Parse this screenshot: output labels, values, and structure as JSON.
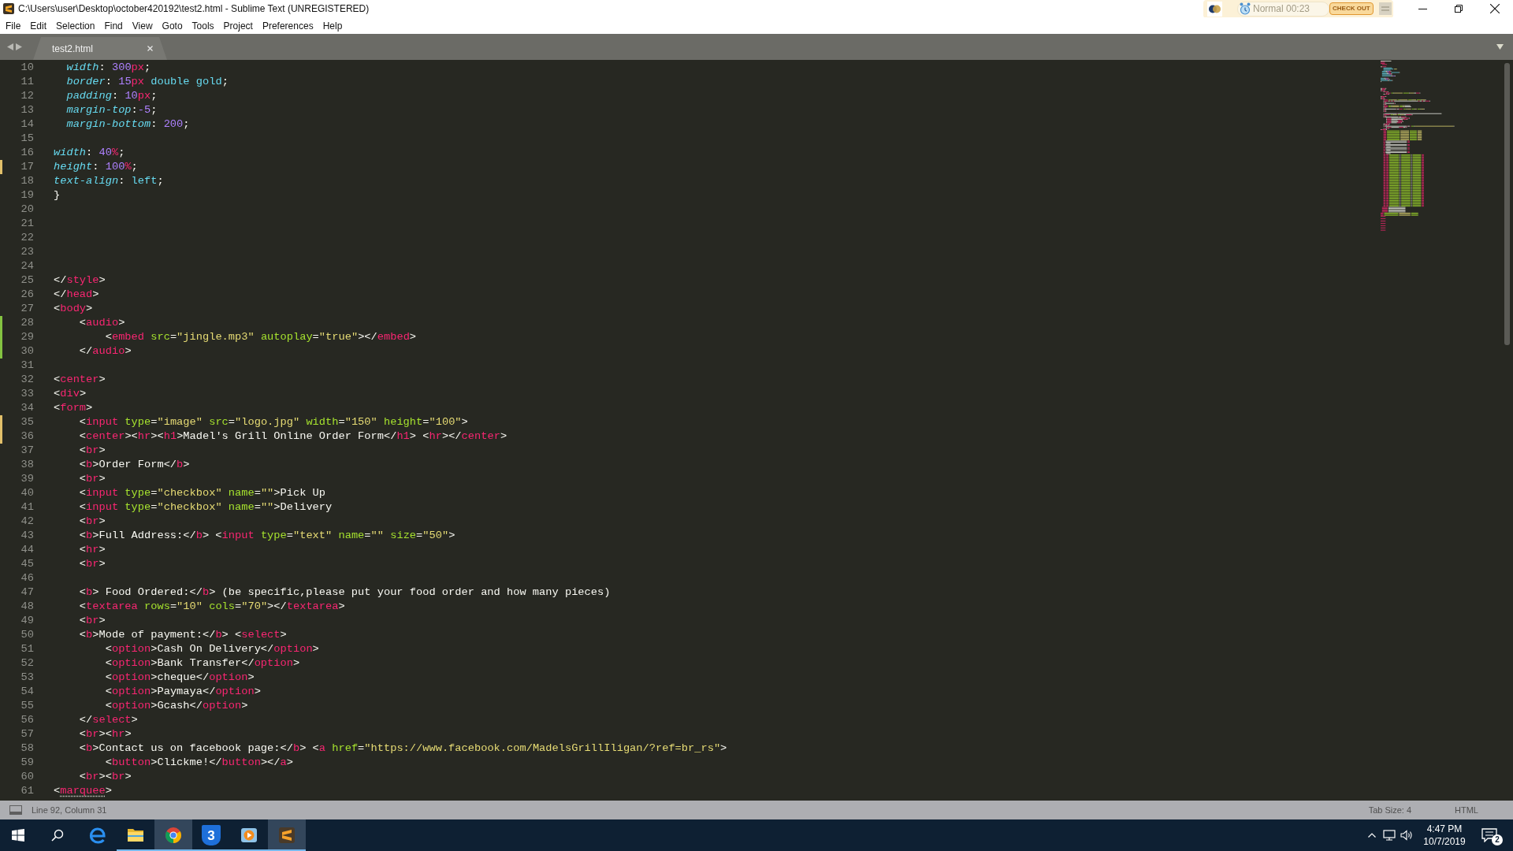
{
  "window": {
    "title": "C:\\Users\\user\\Desktop\\october420192\\test2.html - Sublime Text (UNREGISTERED)"
  },
  "recorder_widget": {
    "status": "Normal 00:23",
    "button": "CHECK OUT"
  },
  "menu": [
    "File",
    "Edit",
    "Selection",
    "Find",
    "View",
    "Goto",
    "Tools",
    "Project",
    "Preferences",
    "Help"
  ],
  "tabs": [
    {
      "label": "test2.html",
      "selected": true
    }
  ],
  "editor": {
    "lines": [
      {
        "number": "10",
        "tokens": [
          {
            "kind": "prop",
            "text": "  width"
          },
          {
            "kind": "plain",
            "text": ": "
          },
          {
            "kind": "num",
            "text": "300"
          },
          {
            "kind": "unit",
            "text": "px"
          },
          {
            "kind": "plain",
            "text": ";"
          }
        ]
      },
      {
        "number": "11",
        "tokens": [
          {
            "kind": "prop",
            "text": "  border"
          },
          {
            "kind": "plain",
            "text": ": "
          },
          {
            "kind": "num",
            "text": "15"
          },
          {
            "kind": "unit",
            "text": "px"
          },
          {
            "kind": "const",
            "text": " double gold"
          },
          {
            "kind": "plain",
            "text": ";"
          }
        ]
      },
      {
        "number": "12",
        "tokens": [
          {
            "kind": "prop",
            "text": "  padding"
          },
          {
            "kind": "plain",
            "text": ": "
          },
          {
            "kind": "num",
            "text": "10"
          },
          {
            "kind": "unit",
            "text": "px"
          },
          {
            "kind": "plain",
            "text": ";"
          }
        ]
      },
      {
        "number": "13",
        "tokens": [
          {
            "kind": "prop",
            "text": "  margin-top"
          },
          {
            "kind": "plain",
            "text": ":"
          },
          {
            "kind": "num",
            "text": "-5"
          },
          {
            "kind": "plain",
            "text": ";"
          }
        ]
      },
      {
        "number": "14",
        "tokens": [
          {
            "kind": "prop",
            "text": "  margin-bottom"
          },
          {
            "kind": "plain",
            "text": ": "
          },
          {
            "kind": "num",
            "text": "200"
          },
          {
            "kind": "plain",
            "text": ";"
          }
        ]
      },
      {
        "number": "15"
      },
      {
        "number": "16",
        "tokens": [
          {
            "kind": "prop",
            "text": "width"
          },
          {
            "kind": "plain",
            "text": ": "
          },
          {
            "kind": "num",
            "text": "40"
          },
          {
            "kind": "unit",
            "text": "%"
          },
          {
            "kind": "plain",
            "text": ";"
          }
        ]
      },
      {
        "number": "17",
        "color": "#e2c06a",
        "tokens": [
          {
            "kind": "prop",
            "text": "height"
          },
          {
            "kind": "plain",
            "text": ": "
          },
          {
            "kind": "num",
            "text": "100"
          },
          {
            "kind": "unit",
            "text": "%"
          },
          {
            "kind": "plain",
            "text": ";"
          }
        ]
      },
      {
        "number": "18",
        "tokens": [
          {
            "kind": "prop",
            "text": "text-align"
          },
          {
            "kind": "plain",
            "text": ": "
          },
          {
            "kind": "const",
            "text": "left"
          },
          {
            "kind": "plain",
            "text": ";"
          }
        ]
      },
      {
        "number": "19",
        "tokens": [
          {
            "kind": "plain",
            "text": "}"
          }
        ]
      },
      {
        "number": "20"
      },
      {
        "number": "21"
      },
      {
        "number": "22"
      },
      {
        "number": "23"
      },
      {
        "number": "24"
      },
      {
        "number": "25",
        "tokens": [
          {
            "kind": "plain",
            "text": "</"
          },
          {
            "kind": "tag",
            "text": "style"
          },
          {
            "kind": "plain",
            "text": ">"
          }
        ]
      },
      {
        "number": "26",
        "tokens": [
          {
            "kind": "plain",
            "text": "</"
          },
          {
            "kind": "tag",
            "text": "head"
          },
          {
            "kind": "plain",
            "text": ">"
          }
        ]
      },
      {
        "number": "27",
        "tokens": [
          {
            "kind": "plain",
            "text": "<"
          },
          {
            "kind": "tag",
            "text": "body"
          },
          {
            "kind": "plain",
            "text": ">"
          }
        ]
      },
      {
        "number": "28",
        "color": "#84c341",
        "tokens": [
          {
            "kind": "plain",
            "text": "\t<"
          },
          {
            "kind": "tag",
            "text": "audio"
          },
          {
            "kind": "plain",
            "text": ">"
          }
        ]
      },
      {
        "number": "29",
        "color": "#84c341",
        "tokens": [
          {
            "kind": "plain",
            "text": "\t\t<"
          },
          {
            "kind": "tag",
            "text": "embed"
          },
          {
            "kind": "attr",
            "text": " src"
          },
          {
            "kind": "plain",
            "text": "="
          },
          {
            "kind": "str",
            "text": "\"jingle.mp3\""
          },
          {
            "kind": "attr",
            "text": " autoplay"
          },
          {
            "kind": "plain",
            "text": "="
          },
          {
            "kind": "str",
            "text": "\"true\""
          },
          {
            "kind": "plain",
            "text": "></"
          },
          {
            "kind": "tag",
            "text": "embed"
          },
          {
            "kind": "plain",
            "text": ">"
          }
        ]
      },
      {
        "number": "30",
        "color": "#84c341",
        "tokens": [
          {
            "kind": "plain",
            "text": "\t</"
          },
          {
            "kind": "tag",
            "text": "audio"
          },
          {
            "kind": "plain",
            "text": ">"
          }
        ]
      },
      {
        "number": "31"
      },
      {
        "number": "32",
        "tokens": [
          {
            "kind": "plain",
            "text": "<"
          },
          {
            "kind": "tag",
            "text": "center"
          },
          {
            "kind": "plain",
            "text": ">"
          }
        ]
      },
      {
        "number": "33",
        "tokens": [
          {
            "kind": "plain",
            "text": "<"
          },
          {
            "kind": "tag",
            "text": "div"
          },
          {
            "kind": "plain",
            "text": ">"
          }
        ]
      },
      {
        "number": "34",
        "tokens": [
          {
            "kind": "plain",
            "text": "<"
          },
          {
            "kind": "tag",
            "text": "form"
          },
          {
            "kind": "plain",
            "text": ">"
          }
        ]
      },
      {
        "number": "35",
        "color": "#e2c06a",
        "tokens": [
          {
            "kind": "plain",
            "text": "\t<"
          },
          {
            "kind": "tag",
            "text": "input"
          },
          {
            "kind": "attr",
            "text": " type"
          },
          {
            "kind": "plain",
            "text": "="
          },
          {
            "kind": "str",
            "text": "\"image\""
          },
          {
            "kind": "attr",
            "text": " src"
          },
          {
            "kind": "plain",
            "text": "="
          },
          {
            "kind": "str",
            "text": "\"logo.jpg\""
          },
          {
            "kind": "attr",
            "text": " width"
          },
          {
            "kind": "plain",
            "text": "="
          },
          {
            "kind": "str",
            "text": "\"150\""
          },
          {
            "kind": "attr",
            "text": " height"
          },
          {
            "kind": "plain",
            "text": "="
          },
          {
            "kind": "str",
            "text": "\"100\""
          },
          {
            "kind": "plain",
            "text": ">"
          }
        ]
      },
      {
        "number": "36",
        "color": "#e2c06a",
        "tokens": [
          {
            "kind": "plain",
            "text": "\t<"
          },
          {
            "kind": "tag",
            "text": "center"
          },
          {
            "kind": "plain",
            "text": "><"
          },
          {
            "kind": "tag",
            "text": "hr"
          },
          {
            "kind": "plain",
            "text": "><"
          },
          {
            "kind": "tag",
            "text": "h1"
          },
          {
            "kind": "plain",
            "text": ">Madel's Grill Online Order Form</"
          },
          {
            "kind": "tag",
            "text": "h1"
          },
          {
            "kind": "plain",
            "text": "> <"
          },
          {
            "kind": "tag",
            "text": "hr"
          },
          {
            "kind": "plain",
            "text": "></"
          },
          {
            "kind": "tag",
            "text": "center"
          },
          {
            "kind": "plain",
            "text": ">"
          }
        ]
      },
      {
        "number": "37",
        "tokens": [
          {
            "kind": "plain",
            "text": "\t<"
          },
          {
            "kind": "tag",
            "text": "br"
          },
          {
            "kind": "plain",
            "text": ">"
          }
        ]
      },
      {
        "number": "38",
        "tokens": [
          {
            "kind": "plain",
            "text": "\t<"
          },
          {
            "kind": "tag",
            "text": "b"
          },
          {
            "kind": "plain",
            "text": ">Order Form</"
          },
          {
            "kind": "tag",
            "text": "b"
          },
          {
            "kind": "plain",
            "text": ">"
          }
        ]
      },
      {
        "number": "39",
        "tokens": [
          {
            "kind": "plain",
            "text": "\t<"
          },
          {
            "kind": "tag",
            "text": "br"
          },
          {
            "kind": "plain",
            "text": ">"
          }
        ]
      },
      {
        "number": "40",
        "tokens": [
          {
            "kind": "plain",
            "text": "\t<"
          },
          {
            "kind": "tag",
            "text": "input"
          },
          {
            "kind": "attr",
            "text": " type"
          },
          {
            "kind": "plain",
            "text": "="
          },
          {
            "kind": "str",
            "text": "\"checkbox\""
          },
          {
            "kind": "attr",
            "text": " name"
          },
          {
            "kind": "plain",
            "text": "="
          },
          {
            "kind": "str",
            "text": "\"\""
          },
          {
            "kind": "plain",
            "text": ">Pick Up"
          }
        ]
      },
      {
        "number": "41",
        "tokens": [
          {
            "kind": "plain",
            "text": "\t<"
          },
          {
            "kind": "tag",
            "text": "input"
          },
          {
            "kind": "attr",
            "text": " type"
          },
          {
            "kind": "plain",
            "text": "="
          },
          {
            "kind": "str",
            "text": "\"checkbox\""
          },
          {
            "kind": "attr",
            "text": " name"
          },
          {
            "kind": "plain",
            "text": "="
          },
          {
            "kind": "str",
            "text": "\"\""
          },
          {
            "kind": "plain",
            "text": ">Delivery"
          }
        ]
      },
      {
        "number": "42",
        "tokens": [
          {
            "kind": "plain",
            "text": "\t<"
          },
          {
            "kind": "tag",
            "text": "br"
          },
          {
            "kind": "plain",
            "text": ">"
          }
        ]
      },
      {
        "number": "43",
        "tokens": [
          {
            "kind": "plain",
            "text": "\t<"
          },
          {
            "kind": "tag",
            "text": "b"
          },
          {
            "kind": "plain",
            "text": ">Full Address:</"
          },
          {
            "kind": "tag",
            "text": "b"
          },
          {
            "kind": "plain",
            "text": "> <"
          },
          {
            "kind": "tag",
            "text": "input"
          },
          {
            "kind": "attr",
            "text": " type"
          },
          {
            "kind": "plain",
            "text": "="
          },
          {
            "kind": "str",
            "text": "\"text\""
          },
          {
            "kind": "attr",
            "text": " name"
          },
          {
            "kind": "plain",
            "text": "="
          },
          {
            "kind": "str",
            "text": "\"\""
          },
          {
            "kind": "attr",
            "text": " size"
          },
          {
            "kind": "plain",
            "text": "="
          },
          {
            "kind": "str",
            "text": "\"50\""
          },
          {
            "kind": "plain",
            "text": ">"
          }
        ]
      },
      {
        "number": "44",
        "tokens": [
          {
            "kind": "plain",
            "text": "\t<"
          },
          {
            "kind": "tag",
            "text": "hr"
          },
          {
            "kind": "plain",
            "text": ">"
          }
        ]
      },
      {
        "number": "45",
        "tokens": [
          {
            "kind": "plain",
            "text": "\t<"
          },
          {
            "kind": "tag",
            "text": "br"
          },
          {
            "kind": "plain",
            "text": ">"
          }
        ]
      },
      {
        "number": "46"
      },
      {
        "number": "47",
        "tokens": [
          {
            "kind": "plain",
            "text": "\t<"
          },
          {
            "kind": "tag",
            "text": "b"
          },
          {
            "kind": "plain",
            "text": "> Food Ordered:</"
          },
          {
            "kind": "tag",
            "text": "b"
          },
          {
            "kind": "plain",
            "text": "> (be specific,please put your food order and how many pieces)"
          }
        ]
      },
      {
        "number": "48",
        "tokens": [
          {
            "kind": "plain",
            "text": "\t<"
          },
          {
            "kind": "tag",
            "text": "textarea"
          },
          {
            "kind": "attr",
            "text": " rows"
          },
          {
            "kind": "plain",
            "text": "="
          },
          {
            "kind": "str",
            "text": "\"10\""
          },
          {
            "kind": "attr",
            "text": " cols"
          },
          {
            "kind": "plain",
            "text": "="
          },
          {
            "kind": "str",
            "text": "\"70\""
          },
          {
            "kind": "plain",
            "text": "></"
          },
          {
            "kind": "tag",
            "text": "textarea"
          },
          {
            "kind": "plain",
            "text": ">"
          }
        ]
      },
      {
        "number": "49",
        "tokens": [
          {
            "kind": "plain",
            "text": "\t<"
          },
          {
            "kind": "tag",
            "text": "br"
          },
          {
            "kind": "plain",
            "text": ">"
          }
        ]
      },
      {
        "number": "50",
        "tokens": [
          {
            "kind": "plain",
            "text": "\t<"
          },
          {
            "kind": "tag",
            "text": "b"
          },
          {
            "kind": "plain",
            "text": ">Mode of payment:</"
          },
          {
            "kind": "tag",
            "text": "b"
          },
          {
            "kind": "plain",
            "text": "> <"
          },
          {
            "kind": "tag",
            "text": "select"
          },
          {
            "kind": "plain",
            "text": ">"
          }
        ]
      },
      {
        "number": "51",
        "tokens": [
          {
            "kind": "plain",
            "text": "\t\t<"
          },
          {
            "kind": "tag",
            "text": "option"
          },
          {
            "kind": "plain",
            "text": ">Cash On Delivery</"
          },
          {
            "kind": "tag",
            "text": "option"
          },
          {
            "kind": "plain",
            "text": ">"
          }
        ]
      },
      {
        "number": "52",
        "tokens": [
          {
            "kind": "plain",
            "text": "\t\t<"
          },
          {
            "kind": "tag",
            "text": "option"
          },
          {
            "kind": "plain",
            "text": ">Bank Transfer</"
          },
          {
            "kind": "tag",
            "text": "option"
          },
          {
            "kind": "plain",
            "text": ">"
          }
        ]
      },
      {
        "number": "53",
        "tokens": [
          {
            "kind": "plain",
            "text": "\t\t<"
          },
          {
            "kind": "tag",
            "text": "option"
          },
          {
            "kind": "plain",
            "text": ">cheque</"
          },
          {
            "kind": "tag",
            "text": "option"
          },
          {
            "kind": "plain",
            "text": ">"
          }
        ]
      },
      {
        "number": "54",
        "tokens": [
          {
            "kind": "plain",
            "text": "\t\t<"
          },
          {
            "kind": "tag",
            "text": "option"
          },
          {
            "kind": "plain",
            "text": ">Paymaya</"
          },
          {
            "kind": "tag",
            "text": "option"
          },
          {
            "kind": "plain",
            "text": ">"
          }
        ]
      },
      {
        "number": "55",
        "tokens": [
          {
            "kind": "plain",
            "text": "\t\t<"
          },
          {
            "kind": "tag",
            "text": "option"
          },
          {
            "kind": "plain",
            "text": ">Gcash</"
          },
          {
            "kind": "tag",
            "text": "option"
          },
          {
            "kind": "plain",
            "text": ">"
          }
        ]
      },
      {
        "number": "56",
        "tokens": [
          {
            "kind": "plain",
            "text": "\t</"
          },
          {
            "kind": "tag",
            "text": "select"
          },
          {
            "kind": "plain",
            "text": ">"
          }
        ]
      },
      {
        "number": "57",
        "tokens": [
          {
            "kind": "plain",
            "text": "\t<"
          },
          {
            "kind": "tag",
            "text": "br"
          },
          {
            "kind": "plain",
            "text": "><"
          },
          {
            "kind": "tag",
            "text": "hr"
          },
          {
            "kind": "plain",
            "text": ">"
          }
        ]
      },
      {
        "number": "58",
        "tokens": [
          {
            "kind": "plain",
            "text": "\t<"
          },
          {
            "kind": "tag",
            "text": "b"
          },
          {
            "kind": "plain",
            "text": ">Contact us on facebook page:</"
          },
          {
            "kind": "tag",
            "text": "b"
          },
          {
            "kind": "plain",
            "text": "> <"
          },
          {
            "kind": "tag",
            "text": "a"
          },
          {
            "kind": "attr",
            "text": " href"
          },
          {
            "kind": "plain",
            "text": "="
          },
          {
            "kind": "str",
            "text": "\"https://www.facebook.com/MadelsGrillIligan/?ref=br_rs\""
          },
          {
            "kind": "plain",
            "text": ">"
          }
        ]
      },
      {
        "number": "59",
        "tokens": [
          {
            "kind": "plain",
            "text": "\t\t<"
          },
          {
            "kind": "tag",
            "text": "button"
          },
          {
            "kind": "plain",
            "text": ">Clickme!</"
          },
          {
            "kind": "tag",
            "text": "button"
          },
          {
            "kind": "plain",
            "text": "></"
          },
          {
            "kind": "tag",
            "text": "a"
          },
          {
            "kind": "plain",
            "text": ">"
          }
        ]
      },
      {
        "number": "60",
        "tokens": [
          {
            "kind": "plain",
            "text": "\t<"
          },
          {
            "kind": "tag",
            "text": "br"
          },
          {
            "kind": "plain",
            "text": "><"
          },
          {
            "kind": "tag",
            "text": "br"
          },
          {
            "kind": "plain",
            "text": ">"
          }
        ]
      },
      {
        "number": "61",
        "tokens": [
          {
            "kind": "plain",
            "text": "<"
          },
          {
            "kind": "flagged",
            "text": "marquee"
          },
          {
            "kind": "plain",
            "text": ">"
          }
        ]
      }
    ]
  },
  "status_bar": {
    "position": "Line 92, Column 31",
    "tab_size": "Tab Size: 4",
    "syntax": "HTML"
  },
  "taskbar": {
    "apps": [
      {
        "kind": "browser",
        "running": false,
        "active": false
      },
      {
        "kind": "folder",
        "running": true,
        "active": false
      },
      {
        "kind": "wheel",
        "running": true,
        "active": true
      },
      {
        "kind": "tile",
        "label": "3",
        "running": true,
        "active": false
      },
      {
        "kind": "player",
        "running": true,
        "active": false
      },
      {
        "kind": "editor",
        "running": true,
        "active": true
      }
    ],
    "clock": {
      "time": "4:47 PM",
      "date": "10/7/2019"
    },
    "notification_count": "2"
  }
}
